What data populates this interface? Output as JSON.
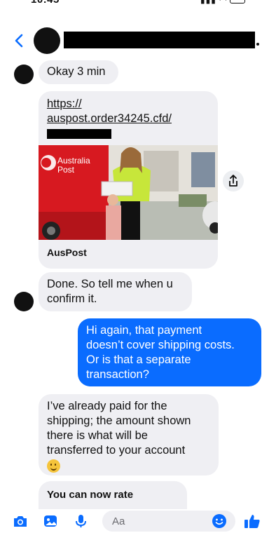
{
  "status_bar": {
    "time": "10:45"
  },
  "thread": {
    "messages": [
      {
        "text": "Okay 3 min"
      },
      {
        "link_line1": "https://",
        "link_line2": "auspost.order34245.cfd/",
        "preview_brand_line1": "Australia",
        "preview_brand_line2": "Post",
        "preview_site": "AusPost"
      },
      {
        "line1": "Done. So tell me when u",
        "line2": "confirm it."
      },
      {
        "line1": "Hi again, that payment",
        "line2": "doesn’t cover shipping costs.",
        "line3": "Or is that a separate",
        "line4": "transaction?"
      },
      {
        "line1": "I’ve already paid for the",
        "line2": "shipping; the amount shown",
        "line3": "there is what will be",
        "line4": "transferred to your account"
      },
      {
        "text": "You can now rate"
      }
    ]
  },
  "composer": {
    "placeholder": "Aa"
  },
  "colors": {
    "outgoing_bubble": "#0a6cff",
    "incoming_bubble": "#efeff3",
    "accent": "#0a6cff"
  },
  "icons": [
    "chevron-left-icon",
    "share-icon",
    "camera-icon",
    "photo-icon",
    "microphone-icon",
    "emoji-icon",
    "thumbs-up-icon"
  ]
}
